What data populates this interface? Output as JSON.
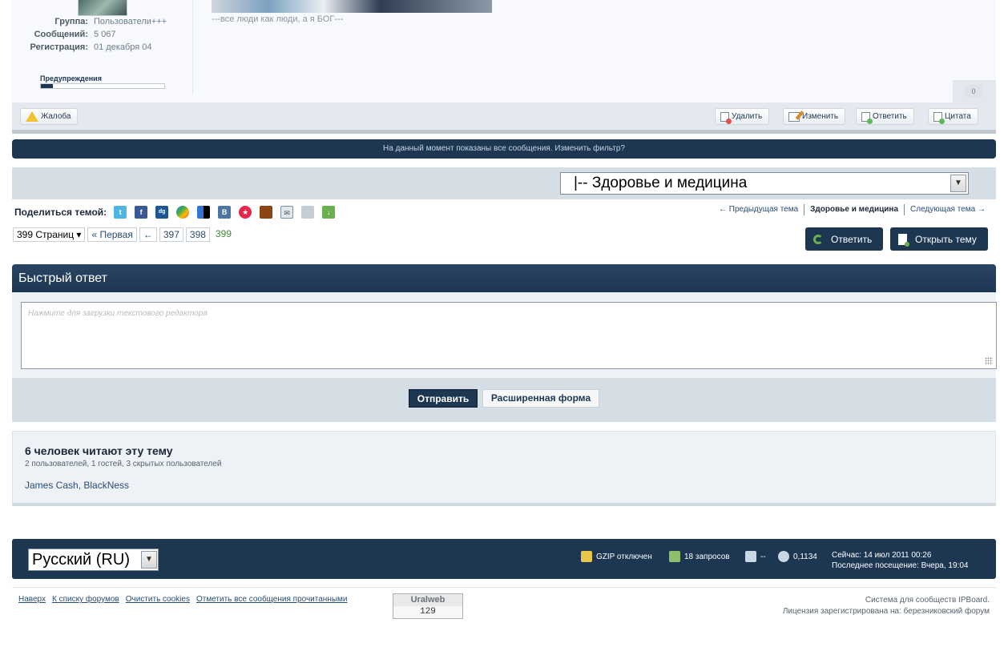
{
  "author": {
    "group_label": "Группа:",
    "group_value": "Пользователи+++",
    "posts_label": "Сообщений:",
    "posts_value": "5 067",
    "reg_label": "Регистрация:",
    "reg_value": "01 декабря 04",
    "warnings_label": "Предупреждения",
    "warnings_level": 0.1
  },
  "post": {
    "signature": "---все люди как люди, а я БОГ---",
    "reputation": "0"
  },
  "controls": {
    "report": "Жалоба",
    "delete": "Удалить",
    "edit": "Изменить",
    "reply": "Ответить",
    "quote": "Цитата"
  },
  "filter_notice": "На данный момент показаны все сообщения. Изменить фильтр?",
  "forum_jump": {
    "selected": "|-- Здоровье и медицина"
  },
  "share": {
    "label": "Поделиться темой:"
  },
  "topic_nav": {
    "prev": "← Предыдущая тема",
    "current": "Здоровье и медицина",
    "next": "Следующая тема →"
  },
  "pagination": {
    "pages_select": "399 Страниц",
    "first": "« Первая",
    "prev": "←",
    "pages": [
      "397",
      "398"
    ],
    "current": "399"
  },
  "actions": {
    "reply": "Ответить",
    "new_topic": "Открыть тему"
  },
  "quick_reply": {
    "title": "Быстрый ответ",
    "placeholder": "Нажмите для загрузки текстового редактора",
    "submit": "Отправить",
    "advanced": "Расширенная форма"
  },
  "readers": {
    "title": "6 человек читают эту тему",
    "summary": "2 пользователей, 1 гостей, 3 скрытых пользователей",
    "users": "James Cash, BlackNess"
  },
  "footer": {
    "language": "Русский (RU)",
    "gzip": "GZIP отключен",
    "queries": "18 запросов",
    "memory": "--",
    "time": "0,1134",
    "now": "Сейчас: 14 июл 2011 00:26",
    "last_visit": "Последнее посещение: Вчера, 19:04",
    "links": [
      "Наверх",
      "К списку форумов",
      "Очистить cookies",
      "Отметить все сообщения прочитанными"
    ],
    "counter_title": "Uralweb",
    "counter_value": "129",
    "powered": "Система для сообществ IPBoard.",
    "license": "Лицензия зарегистрирована на: березниковский форум"
  }
}
